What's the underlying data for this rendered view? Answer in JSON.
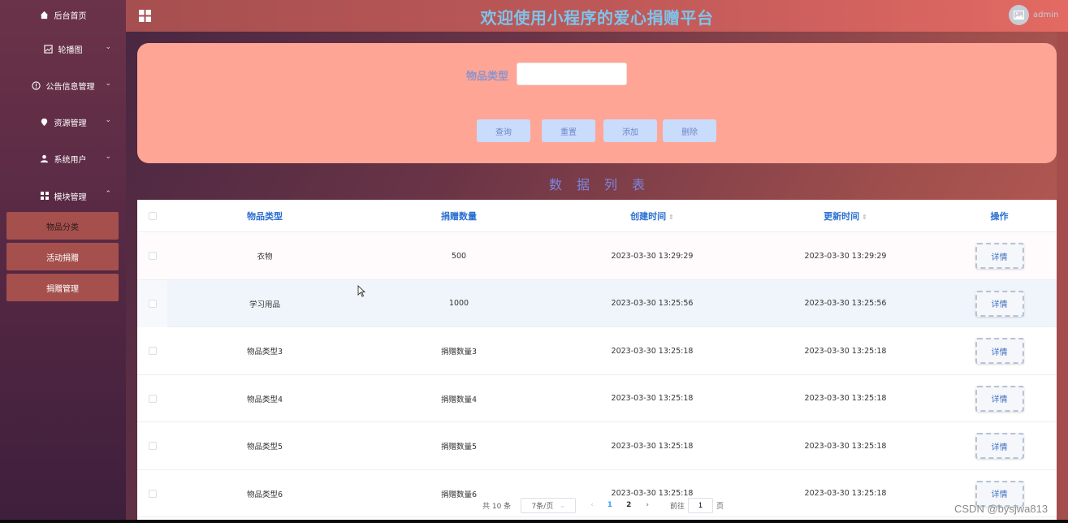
{
  "header": {
    "title": "欢迎使用小程序的爱心捐赠平台",
    "username": "admin"
  },
  "sidebar": {
    "items": [
      {
        "label": "后台首页",
        "icon": "home-icon",
        "has_chevron": false
      },
      {
        "label": "轮播图",
        "icon": "image-icon",
        "has_chevron": true,
        "chevron": "⌄"
      },
      {
        "label": "公告信息管理",
        "icon": "info-circle-icon",
        "has_chevron": true,
        "chevron": "⌄"
      },
      {
        "label": "资源管理",
        "icon": "location-pin-icon",
        "has_chevron": true,
        "chevron": "⌄"
      },
      {
        "label": "系统用户",
        "icon": "user-icon",
        "has_chevron": true,
        "chevron": "⌄"
      },
      {
        "label": "模块管理",
        "icon": "grid-icon",
        "has_chevron": true,
        "chevron": "⌃"
      }
    ],
    "sub_items": [
      {
        "label": "物品分类",
        "active": true
      },
      {
        "label": "活动捐赠",
        "active": false
      },
      {
        "label": "捐赠管理",
        "active": false
      }
    ]
  },
  "search": {
    "label": "物品类型",
    "value": "",
    "placeholder": "",
    "buttons": {
      "query": "查询",
      "reset": "重置",
      "add": "添加",
      "delete": "删除"
    }
  },
  "section_title": "数据列表",
  "table": {
    "columns": {
      "type": "物品类型",
      "quantity": "捐赠数量",
      "created": "创建时间",
      "updated": "更新时间",
      "actions": "操作"
    },
    "sort_icon": "⇕",
    "detail_label": "详情",
    "rows": [
      {
        "type": "衣物",
        "quantity": "500",
        "created": "2023-03-30 13:29:29",
        "updated": "2023-03-30 13:29:29"
      },
      {
        "type": "学习用品",
        "quantity": "1000",
        "created": "2023-03-30 13:25:56",
        "updated": "2023-03-30 13:25:56"
      },
      {
        "type": "物品类型3",
        "quantity": "捐赠数量3",
        "created": "2023-03-30 13:25:18",
        "updated": "2023-03-30 13:25:18"
      },
      {
        "type": "物品类型4",
        "quantity": "捐赠数量4",
        "created": "2023-03-30 13:25:18",
        "updated": "2023-03-30 13:25:18"
      },
      {
        "type": "物品类型5",
        "quantity": "捐赠数量5",
        "created": "2023-03-30 13:25:18",
        "updated": "2023-03-30 13:25:18"
      },
      {
        "type": "物品类型6",
        "quantity": "捐赠数量6",
        "created": "2023-03-30 13:25:18",
        "updated": "2023-03-30 13:25:18"
      }
    ]
  },
  "pagination": {
    "total": "共 10 条",
    "page_size": "7条/页",
    "prev": "‹",
    "next": "›",
    "pages": [
      "1",
      "2"
    ],
    "current_page": "1",
    "goto_label": "前往",
    "goto_value": "1",
    "page_unit": "页"
  },
  "watermark": "CSDN @bysjwa813"
}
